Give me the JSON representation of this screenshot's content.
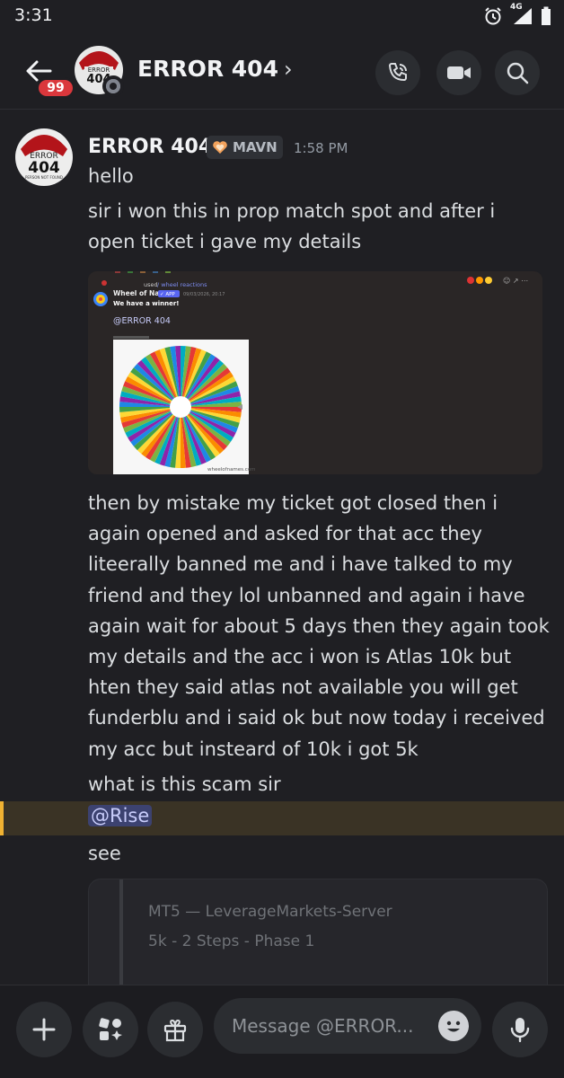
{
  "status_bar": {
    "time": "3:31",
    "network": "4G"
  },
  "header": {
    "back_badge": "99",
    "avatar_line1": "ERROR",
    "avatar_line2": "404",
    "title": "ERROR 404",
    "chevron": "›"
  },
  "message": {
    "author": "ERROR 404",
    "tag": "MAVN",
    "timestamp": "1:58 PM",
    "avatar_line1": "ERROR",
    "avatar_line2": "404",
    "avatar_line3": "PERSON NOT FOUND",
    "lines": [
      "hello",
      "sir i won this in prop match spot and after i open ticket i gave my details"
    ],
    "embed": {
      "used_text": "used",
      "command": "/ wheel reactions",
      "bot_name": "Wheel of Names",
      "app_tag": "✓ APP",
      "bot_date": "09/03/2026, 20:17",
      "winner_text": "We have a winner!",
      "mention": "@ERROR 404",
      "wheel_footer": "wheelofnames.com"
    },
    "body": "then by mistake my ticket got closed then i again opened and asked for that acc they liteerally banned me and i have talked to my friend and they lol unbanned and again i have again wait for about 5 days then they again took my details and the acc i won is Atlas 10k but hten they said atlas not available you will get funderblu and i said ok but now today i received my acc but insteard of 10k i got 5k",
    "question": "what is this scam sir",
    "mention": "@Rise",
    "see": "see",
    "card": {
      "line1": "MT5 — LeverageMarkets-Server",
      "line2": "5k - 2 Steps - Phase 1"
    }
  },
  "composer": {
    "placeholder": "Message @ERROR..."
  },
  "colors": {
    "background": "#1f1f23",
    "mention_highlight": "#f0b232",
    "badge": "#da373c"
  }
}
